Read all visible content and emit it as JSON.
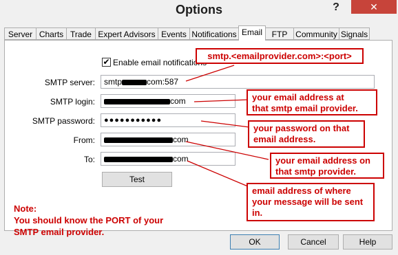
{
  "window": {
    "title": "Options",
    "help_glyph": "?",
    "close_glyph": "✕"
  },
  "tabs": [
    "Server",
    "Charts",
    "Trade",
    "Expert Advisors",
    "Events",
    "Notifications",
    "Email",
    "FTP",
    "Community",
    "Signals"
  ],
  "active_tab": "Email",
  "email": {
    "enable_label": "Enable email notifications",
    "enable_checked": "✔",
    "smtp_server_label": "SMTP server:",
    "smtp_server_prefix": "smtp",
    "smtp_server_suffix": "com:587",
    "smtp_login_label": "SMTP login:",
    "smtp_login_suffix": "com",
    "smtp_password_label": "SMTP password:",
    "smtp_password_value": "●●●●●●●●●●●",
    "from_label": "From:",
    "from_suffix": "com",
    "to_label": "To:",
    "to_suffix": "com",
    "test_button": "Test"
  },
  "annotations": {
    "server": "smtp.<emailprovider.com>:<port>",
    "login_line1": "your email address at",
    "login_line2": "that smtp email provider.",
    "password_line1": "your password on that",
    "password_line2": "email address.",
    "from_line1": "your email address on",
    "from_line2": "that smtp provider.",
    "to_line1": "email address of where",
    "to_line2": "your message will be sent",
    "to_line3": "in.",
    "note_line1": "Note:",
    "note_line2": "You should know the PORT of your",
    "note_line3": "SMTP email provider."
  },
  "footer": {
    "ok": "OK",
    "cancel": "Cancel",
    "help": "Help"
  },
  "colors": {
    "annotation": "#cc0000",
    "close_button": "#c7443a"
  }
}
